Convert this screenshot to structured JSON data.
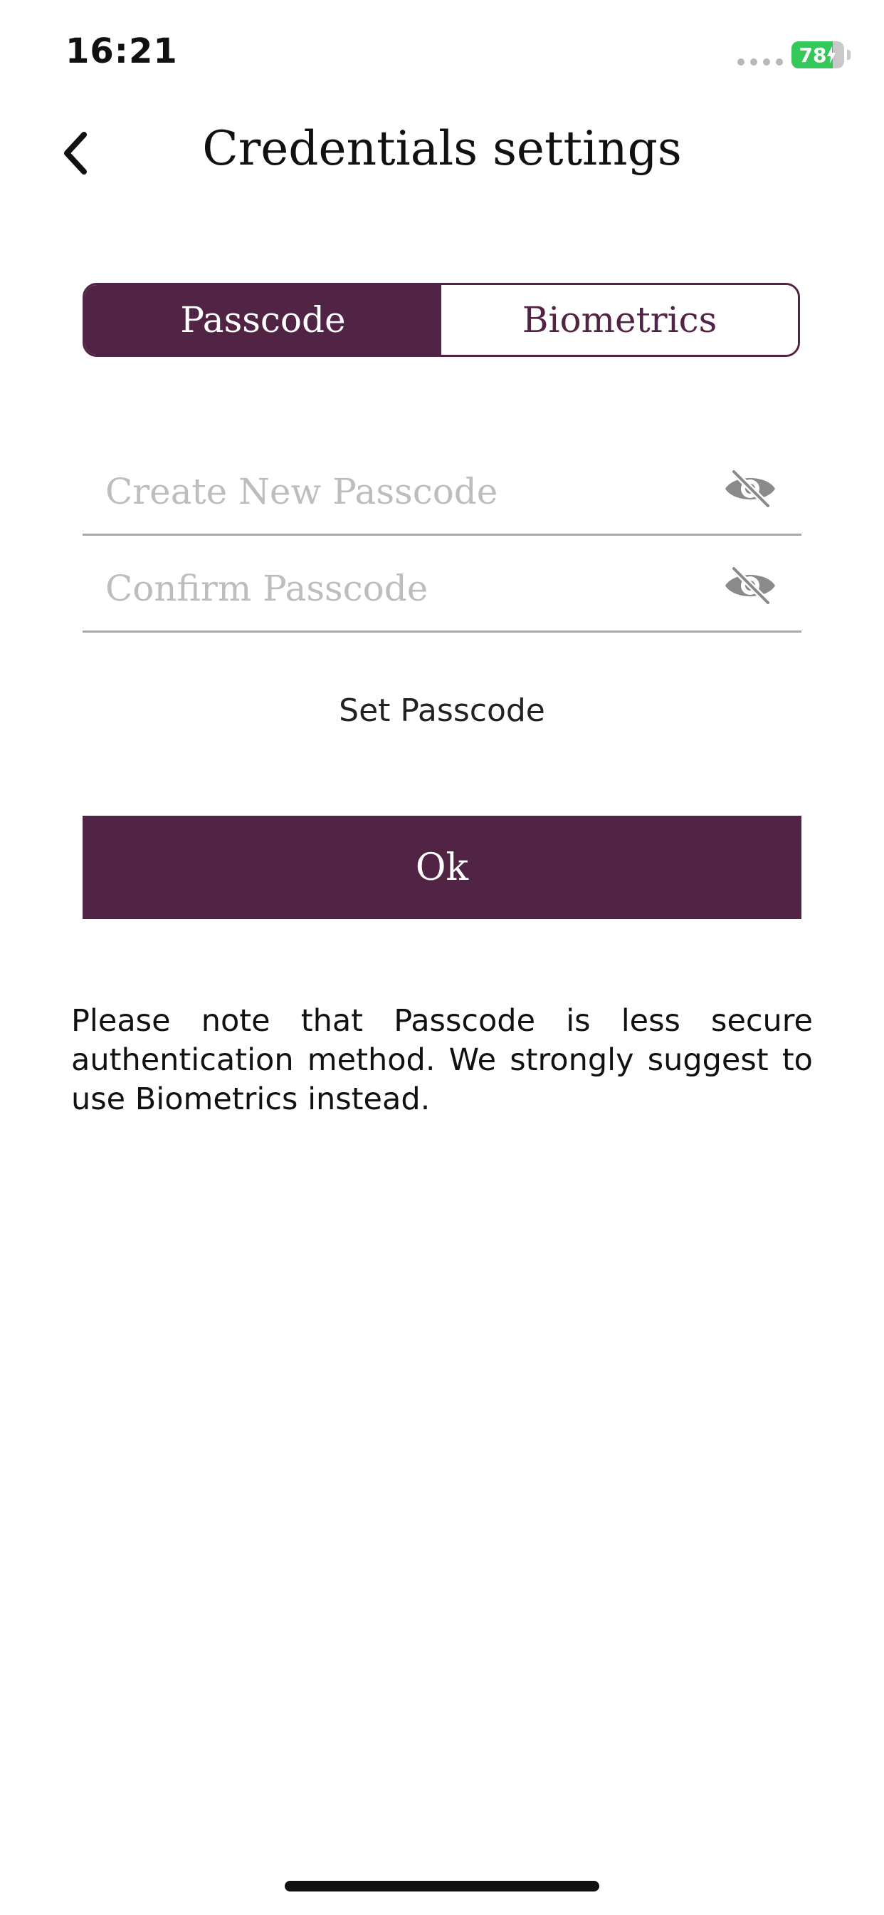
{
  "status_bar": {
    "time": "16:21",
    "battery_level": "78",
    "battery_fraction": 0.78,
    "battery_color": "#34c759"
  },
  "header": {
    "back_icon": "chevron-left-icon",
    "title": "Credentials settings"
  },
  "auth_method_toggle": {
    "options": [
      {
        "label": "Passcode",
        "selected": true
      },
      {
        "label": "Biometrics",
        "selected": false
      }
    ]
  },
  "form": {
    "new_passcode": {
      "value": "",
      "placeholder": "Create New Passcode",
      "visibility_icon": "eye-slash-icon"
    },
    "confirm_passcode": {
      "value": "",
      "placeholder": "Confirm Passcode",
      "visibility_icon": "eye-slash-icon"
    },
    "section_label": "Set Passcode",
    "submit_label": "Ok"
  },
  "note": "Please note that Passcode is less secure authentication method. We strongly suggest to use Biometrics instead.",
  "theme": {
    "accent": "#512445",
    "placeholder": "#bdbdbd",
    "divider": "#a9a9a9"
  }
}
